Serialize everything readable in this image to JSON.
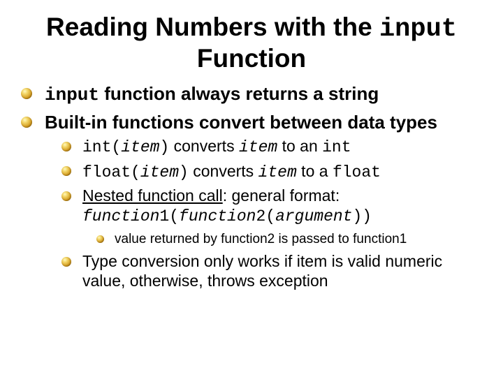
{
  "title": {
    "pre": "Reading Numbers with the ",
    "code": "input",
    "post": " Function"
  },
  "items": [
    {
      "parts": [
        {
          "t": "input",
          "c": "mono"
        },
        {
          "t": " function always returns a string"
        }
      ]
    },
    {
      "parts": [
        {
          "t": "Built-in functions convert between data types"
        }
      ],
      "children": [
        {
          "parts": [
            {
              "t": "int(",
              "c": "mono"
            },
            {
              "t": "item",
              "c": "mono ital"
            },
            {
              "t": ")",
              "c": "mono"
            },
            {
              "t": " converts "
            },
            {
              "t": "item",
              "c": "mono ital"
            },
            {
              "t": " to an "
            },
            {
              "t": "int",
              "c": "mono"
            }
          ]
        },
        {
          "parts": [
            {
              "t": "float(",
              "c": "mono"
            },
            {
              "t": "item",
              "c": "mono ital"
            },
            {
              "t": ")",
              "c": "mono"
            },
            {
              "t": " converts "
            },
            {
              "t": "item",
              "c": "mono ital"
            },
            {
              "t": " to a "
            },
            {
              "t": "float",
              "c": "mono"
            }
          ]
        },
        {
          "parts": [
            {
              "t": "Nested function call",
              "c": "under"
            },
            {
              "t": ": general format: "
            },
            {
              "t": "function",
              "c": "mono ital"
            },
            {
              "t": "1(",
              "c": "mono"
            },
            {
              "t": "function",
              "c": "mono ital"
            },
            {
              "t": "2(",
              "c": "mono"
            },
            {
              "t": "argument",
              "c": "mono ital"
            },
            {
              "t": "))",
              "c": "mono"
            }
          ],
          "children": [
            {
              "parts": [
                {
                  "t": "value returned by function2 is passed to function1"
                }
              ]
            }
          ]
        },
        {
          "parts": [
            {
              "t": "Type conversion only works if item is valid numeric value, otherwise, throws exception"
            }
          ]
        }
      ]
    }
  ]
}
